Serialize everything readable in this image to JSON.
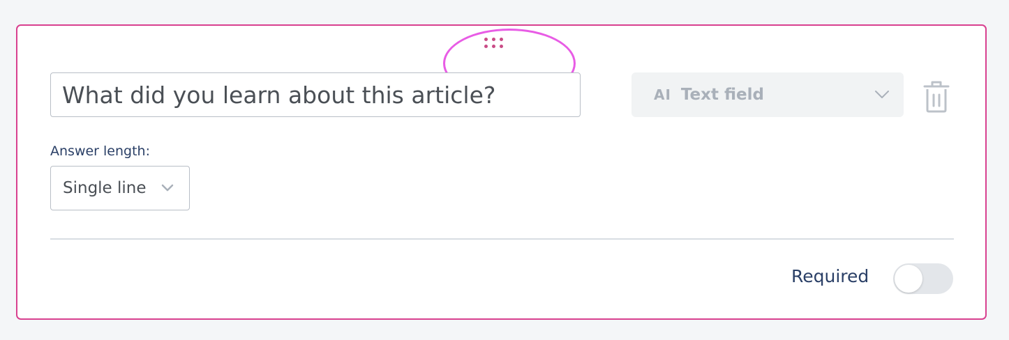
{
  "question": {
    "value": "What did you learn about this article?",
    "type_icon": "AI",
    "type_label": "Text field"
  },
  "answer_length": {
    "label": "Answer length:",
    "selected": "Single line"
  },
  "required": {
    "label": "Required",
    "enabled": false
  },
  "icons": {
    "drag": "drag-handle-icon",
    "type": "text-field-icon",
    "type_chevron": "chevron-down-icon",
    "delete": "trash-icon",
    "length_chevron": "chevron-down-icon"
  },
  "colors": {
    "card_border": "#d8408f",
    "drag_dots": "#c94b86",
    "highlight": "#e85ce5",
    "label_text": "#2a3f66",
    "muted": "#a9b0b9"
  }
}
